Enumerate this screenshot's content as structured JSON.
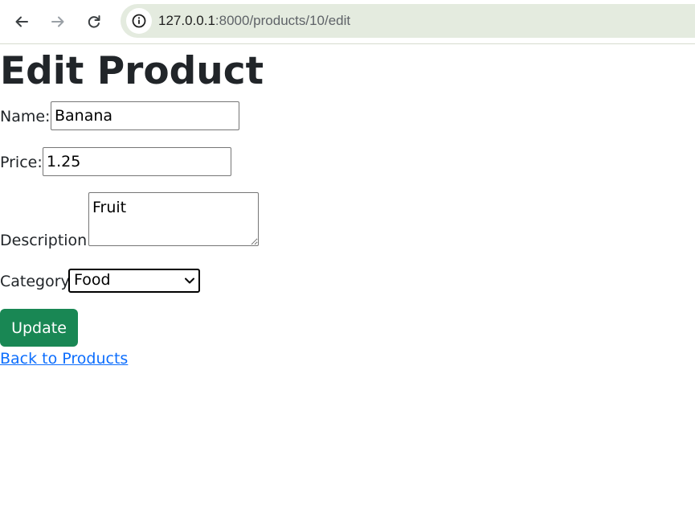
{
  "browser": {
    "url_host": "127.0.0.1",
    "url_rest": ":8000/products/10/edit",
    "icons": {
      "back": "arrow-left-icon",
      "forward": "arrow-right-icon",
      "reload": "reload-icon",
      "site_info": "info-icon"
    }
  },
  "page": {
    "title": "Edit Product"
  },
  "form": {
    "name_label": "Name:",
    "name_value": "Banana",
    "price_label": "Price:",
    "price_value": "1.25",
    "description_label": "Description:",
    "description_value": "Fruit",
    "category_label": "Category",
    "category_value": "Food",
    "submit_label": "Update"
  },
  "links": {
    "back_label": "Back to Products"
  },
  "colors": {
    "submit_button": "#198754",
    "link": "#0d6efd",
    "address_bar": "#e4ebdf"
  }
}
